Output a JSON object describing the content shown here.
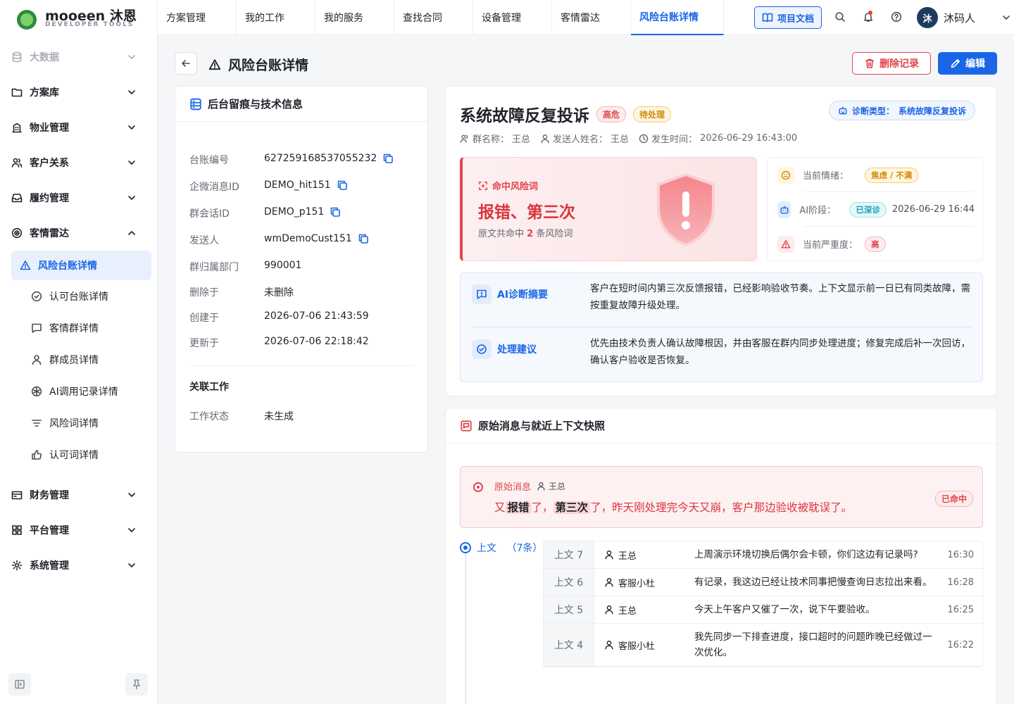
{
  "brand": {
    "name": "mooeen 沐恩",
    "subtitle": "DEVELOPER TOOLS"
  },
  "sidebar": {
    "items": [
      {
        "label": "大数据",
        "icon": "database-icon",
        "dim": true
      },
      {
        "label": "方案库",
        "icon": "folder-icon"
      },
      {
        "label": "物业管理",
        "icon": "building-icon"
      },
      {
        "label": "客户关系",
        "icon": "users-icon"
      },
      {
        "label": "履约管理",
        "icon": "inbox-icon"
      },
      {
        "label": "客情雷达",
        "icon": "radar-icon",
        "expanded": true
      }
    ],
    "sub_items": [
      {
        "label": "风险台账详情",
        "icon": "warning-icon",
        "active": true
      },
      {
        "label": "认可台账详情",
        "icon": "check-circle-icon"
      },
      {
        "label": "客情群详情",
        "icon": "chat-icon"
      },
      {
        "label": "群成员详情",
        "icon": "user-icon"
      },
      {
        "label": "AI调用记录详情",
        "icon": "ai-icon"
      },
      {
        "label": "风险词详情",
        "icon": "filter-icon"
      },
      {
        "label": "认可词详情",
        "icon": "thumbs-up-icon"
      }
    ],
    "bottom_items": [
      {
        "label": "财务管理",
        "icon": "wallet-icon"
      },
      {
        "label": "平台管理",
        "icon": "grid-icon"
      },
      {
        "label": "系统管理",
        "icon": "gear-icon"
      }
    ]
  },
  "topbar": {
    "tabs": [
      "方案管理",
      "我的工作",
      "我的服务",
      "查找合同",
      "设备管理",
      "客情雷达",
      "风险台账详情"
    ],
    "active_tab": 6,
    "docs_label": "项目文档",
    "avatar_text": "沐",
    "user_name": "沐码人"
  },
  "page": {
    "title": "风险台账详情",
    "delete_label": "删除记录",
    "edit_label": "编辑"
  },
  "info_card": {
    "title": "后台留痕与技术信息",
    "fields": [
      {
        "k": "台账编号",
        "v": "627259168537055232",
        "copy": true
      },
      {
        "k": "企微消息ID",
        "v": "DEMO_hit151",
        "copy": true
      },
      {
        "k": "群会话ID",
        "v": "DEMO_p151",
        "copy": true
      },
      {
        "k": "发送人",
        "v": "wmDemoCust151",
        "copy": true
      },
      {
        "k": "群归属部门",
        "v": "990001"
      },
      {
        "k": "删除于",
        "v": "未删除"
      },
      {
        "k": "创建于",
        "v": "2026-07-06 21:43:59"
      },
      {
        "k": "更新于",
        "v": "2026-07-06 22:18:42"
      }
    ],
    "related_title": "关联工作",
    "related_fields": [
      {
        "k": "工作状态",
        "v": "未生成"
      }
    ]
  },
  "ticket": {
    "title": "系统故障反复投诉",
    "level_tag": "高危",
    "status_tag": "待处理",
    "diag_label": "诊断类型：",
    "diag_value": "系统故障反复投诉",
    "group_label": "群名称：",
    "group_value": "王总",
    "sender_label": "发送人姓名：",
    "sender_value": "王总",
    "time_label": "发生时间：",
    "time_value": "2026-06-29 16:43:00",
    "risk": {
      "label": "命中风险词",
      "words": "报错、第三次",
      "count_prefix": "原文共命中",
      "count": "2",
      "count_suffix": "条风险词"
    },
    "states": [
      {
        "label": "当前情绪：",
        "value": "焦虑 / 不满",
        "icon": "emotion-icon",
        "color": "#d18a0b"
      },
      {
        "label": "AI阶段：",
        "value": "已深诊",
        "extra": "2026-06-29 16:44",
        "icon": "robot-icon",
        "color": "#1aa0b8"
      },
      {
        "label": "当前严重度：",
        "value": "高",
        "icon": "alert-icon",
        "color": "#e0464d"
      }
    ],
    "summary": {
      "title": "AI诊断摘要",
      "text": "客户在短时间内第三次反馈报错，已经影响验收节奏。上下文显示前一日已有同类故障，需按重复故障升级处理。"
    },
    "advice": {
      "title": "处理建议",
      "text": "优先由技术负责人确认故障根因，并由客服在群内同步处理进度；修复完成后补一次回访，确认客户验收是否恢复。"
    }
  },
  "context": {
    "title": "原始消息与就近上下文快照",
    "original": {
      "label": "原始消息",
      "sender": "王总",
      "parts": [
        "又",
        "报错",
        "了，",
        "第三次",
        "了，昨天刚处理完今天又崩，客户那边验收被耽误了。"
      ],
      "hit_tag": "已命中"
    },
    "before_label": "上文",
    "before_count": "（7条）",
    "rows": [
      {
        "idx": "上文 7",
        "who": "王总",
        "msg": "上周演示环境切换后偶尔会卡顿，你们这边有记录吗?",
        "time": "16:30"
      },
      {
        "idx": "上文 6",
        "who": "客服小杜",
        "msg": "有记录，我这边已经让技术同事把慢查询日志拉出来看。",
        "time": "16:28"
      },
      {
        "idx": "上文 5",
        "who": "王总",
        "msg": "今天上午客户又催了一次，说下午要验收。",
        "time": "16:25"
      },
      {
        "idx": "上文 4",
        "who": "客服小杜",
        "msg": "我先同步一下排查进度，接口超时的问题昨晚已经做过一次优化。",
        "time": "16:22"
      }
    ]
  }
}
